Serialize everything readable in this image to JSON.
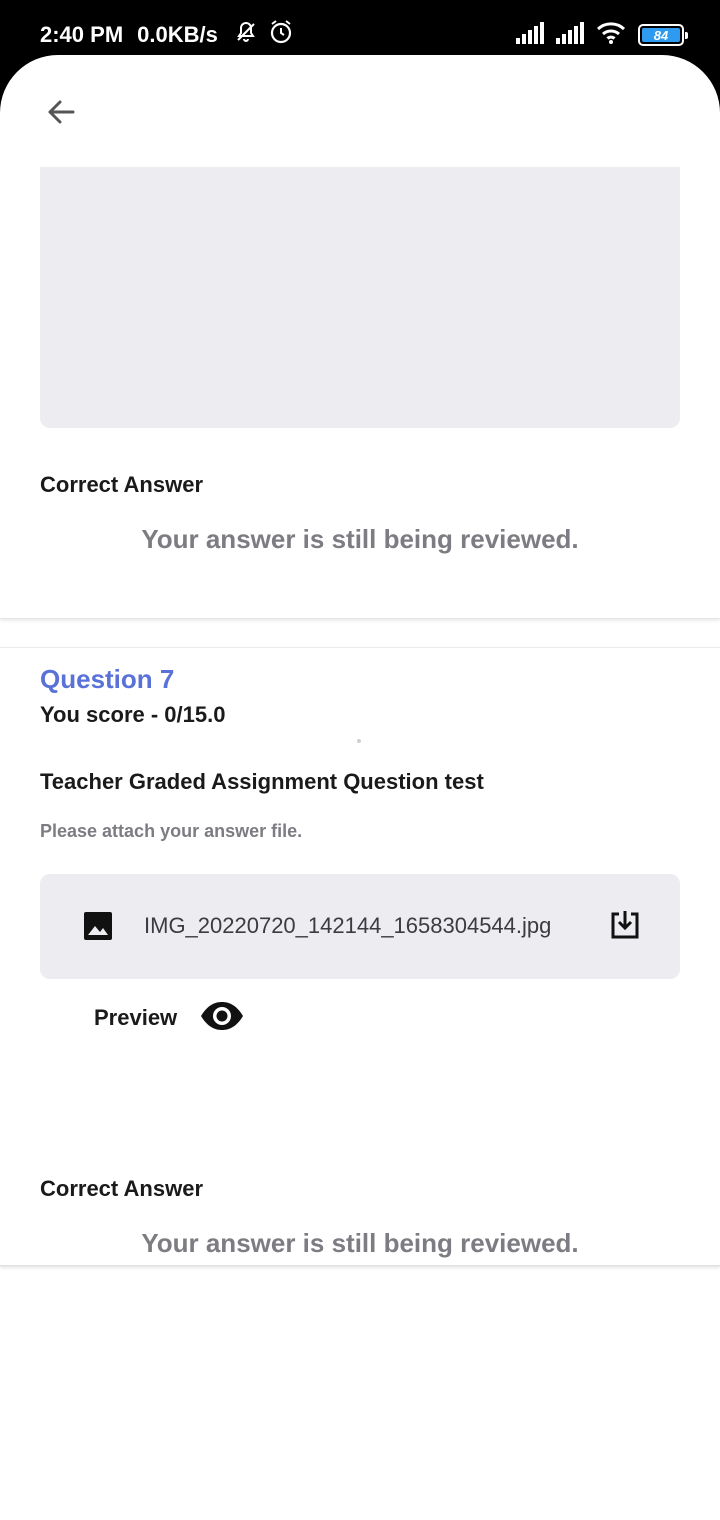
{
  "status_bar": {
    "time": "2:40 PM",
    "speed": "0.0KB/s",
    "battery": "84",
    "icons": [
      "notifications-off-icon",
      "alarm-icon",
      "signal-icon",
      "signal-icon",
      "wifi-icon",
      "battery-icon"
    ]
  },
  "header": {
    "back_icon": "arrow-back-icon"
  },
  "previous_question": {
    "correct_answer_label": "Correct Answer",
    "review_status": "Your answer is still being reviewed."
  },
  "question7": {
    "title": "Question 7",
    "score": "You score - 0/15.0",
    "question_text": "Teacher Graded Assignment Question test",
    "hint": "Please attach your answer file.",
    "file": {
      "icon": "image-icon",
      "name": "IMG_20220720_142144_1658304544.jpg",
      "download_icon": "download-icon"
    },
    "preview_label": "Preview",
    "preview_icon": "eye-icon",
    "correct_answer_label": "Correct Answer",
    "review_status": "Your answer is still being reviewed."
  },
  "colors": {
    "accent": "#5a72d8",
    "muted_text": "#7c7c82",
    "panel_bg": "#ececf1",
    "battery": "#2f9bf0"
  }
}
